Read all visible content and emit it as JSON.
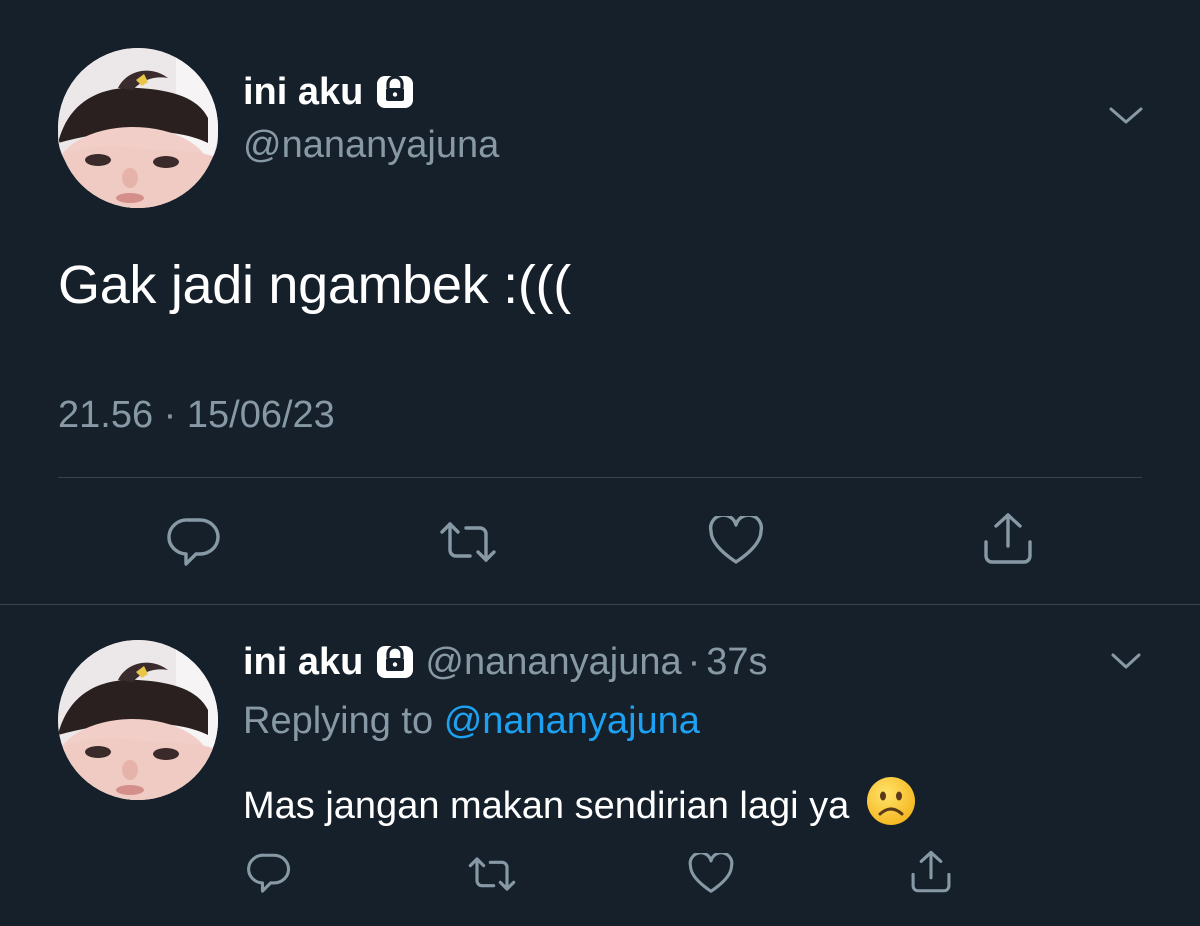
{
  "main_tweet": {
    "display_name": "ini aku",
    "handle": "@nananyajuna",
    "text": "Gak jadi ngambek :(((",
    "timestamp": "21.56 · 15/06/23",
    "icons": [
      "lock-icon",
      "chevron-down-icon",
      "reply-icon",
      "retweet-icon",
      "like-icon",
      "share-icon"
    ]
  },
  "reply_tweet": {
    "display_name": "ini aku",
    "handle": "@nananyajuna",
    "separator": "·",
    "age": "37s",
    "replying_prefix": "Replying to",
    "replying_to": "@nananyajuna",
    "text": "Mas jangan makan sendirian lagi ya",
    "emoji": "frowning-face-emoji",
    "icons": [
      "lock-icon",
      "chevron-down-icon",
      "reply-icon",
      "retweet-icon",
      "like-icon",
      "share-icon"
    ]
  },
  "colors": {
    "background": "#15202b",
    "secondary_text": "#8899a6",
    "divider": "#38444d",
    "link": "#1da1f2",
    "primary_text": "#ffffff"
  }
}
